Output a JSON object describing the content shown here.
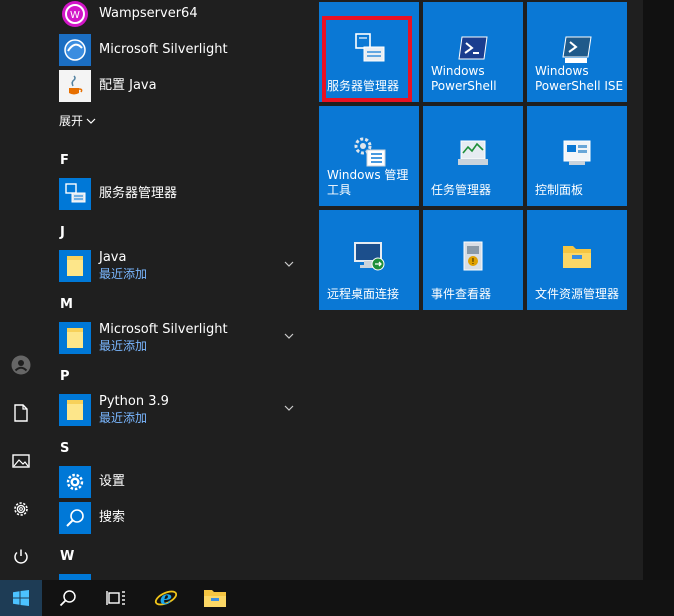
{
  "rail": {
    "items": [
      {
        "name": "user-icon"
      },
      {
        "name": "documents-icon"
      },
      {
        "name": "pictures-icon"
      },
      {
        "name": "settings-icon"
      },
      {
        "name": "power-icon"
      }
    ]
  },
  "applist": {
    "expand_label": "展开",
    "items": [
      {
        "label": "Wampserver64",
        "icon": "wampserver-icon"
      },
      {
        "label": "Microsoft Silverlight",
        "icon": "silverlight-icon"
      },
      {
        "label": "配置 Java",
        "icon": "java-icon"
      }
    ],
    "sections": [
      {
        "letter": "F",
        "items": [
          {
            "label": "服务器管理器",
            "icon": "server-manager-icon"
          }
        ]
      },
      {
        "letter": "J",
        "items": [
          {
            "label": "Java",
            "sublabel": "最近添加",
            "icon": "folder-icon",
            "expandable": true
          }
        ]
      },
      {
        "letter": "M",
        "items": [
          {
            "label": "Microsoft Silverlight",
            "sublabel": "最近添加",
            "icon": "folder-icon",
            "expandable": true
          }
        ]
      },
      {
        "letter": "P",
        "items": [
          {
            "label": "Python 3.9",
            "sublabel": "最近添加",
            "icon": "folder-icon",
            "expandable": true
          }
        ]
      },
      {
        "letter": "S",
        "items": [
          {
            "label": "设置",
            "icon": "gear-icon"
          },
          {
            "label": "搜索",
            "icon": "search-icon"
          }
        ]
      },
      {
        "letter": "W",
        "items": []
      }
    ]
  },
  "tiles": [
    {
      "label": "服务器管理器",
      "icon": "server-manager-icon",
      "highlighted": true
    },
    {
      "label": "Windows\nPowerShell",
      "icon": "powershell-icon"
    },
    {
      "label": "Windows\nPowerShell ISE",
      "icon": "powershell-ise-icon"
    },
    {
      "label": "Windows 管理\n工具",
      "icon": "admin-tools-icon"
    },
    {
      "label": "任务管理器",
      "icon": "task-manager-icon"
    },
    {
      "label": "控制面板",
      "icon": "control-panel-icon"
    },
    {
      "label": "远程桌面连接",
      "icon": "remote-desktop-icon"
    },
    {
      "label": "事件查看器",
      "icon": "event-viewer-icon"
    },
    {
      "label": "文件资源管理器",
      "icon": "file-explorer-icon"
    }
  ],
  "taskbar": {
    "items": [
      {
        "name": "start-button"
      },
      {
        "name": "search-button"
      },
      {
        "name": "task-view-button"
      },
      {
        "name": "internet-explorer-button"
      },
      {
        "name": "file-explorer-button"
      }
    ]
  },
  "colors": {
    "tile": "#0a78d5",
    "highlight": "#e81123",
    "accent": "#0078d7",
    "sublabel": "#7ab7ff"
  }
}
